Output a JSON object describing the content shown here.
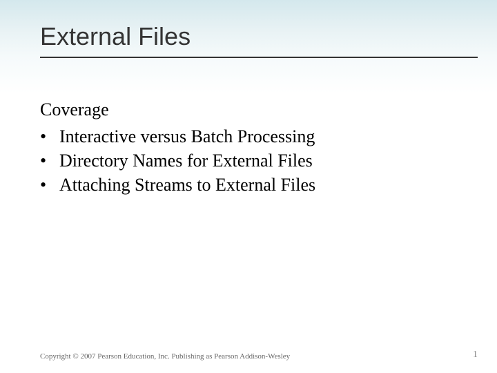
{
  "title": "External Files",
  "section_heading": "Coverage",
  "bullets": [
    "Interactive versus Batch Processing",
    "Directory Names for External Files",
    "Attaching Streams to External Files"
  ],
  "footer": "Copyright © 2007 Pearson Education, Inc. Publishing as Pearson Addison-Wesley",
  "page_number": "1"
}
